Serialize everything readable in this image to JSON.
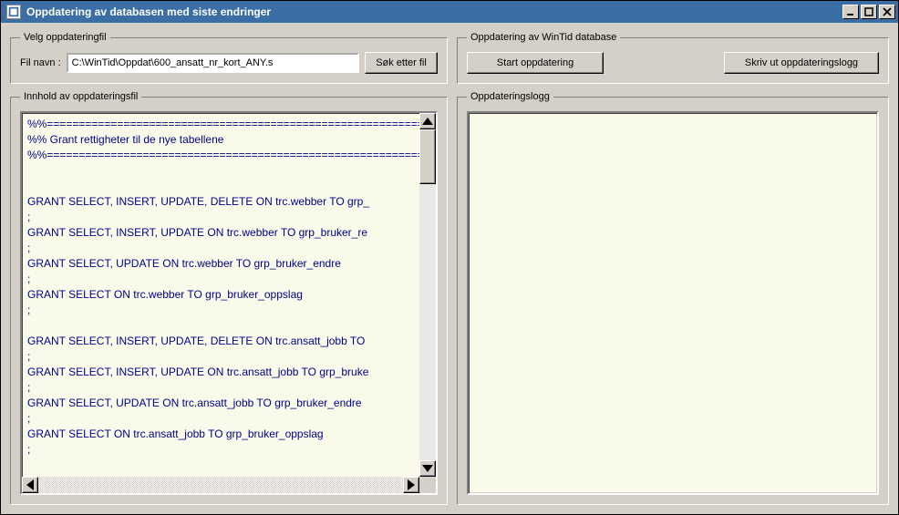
{
  "window": {
    "title": "Oppdatering av databasen med siste endringer"
  },
  "groups": {
    "selectFile": "Velg oppdateringfil",
    "dbUpdate": "Oppdatering av WinTid database",
    "fileContents": "Innhold av oppdateringsfil",
    "log": "Oppdateringslogg"
  },
  "labels": {
    "fileName": "Fil navn :"
  },
  "buttons": {
    "browse": "Søk etter fil",
    "start": "Start oppdatering",
    "printLog": "Skriv ut oppdateringslogg"
  },
  "fields": {
    "filePath": "C:\\WinTid\\Oppdat\\600_ansatt_nr_kort_ANY.s"
  },
  "fileContentLines": [
    "%%==============================================================================",
    "%% Grant rettigheter til de nye tabellene",
    "%%==============================================================================",
    "",
    "",
    "GRANT SELECT, INSERT, UPDATE, DELETE ON trc.webber TO grp_",
    ";",
    "GRANT SELECT, INSERT, UPDATE  ON trc.webber TO grp_bruker_re",
    ";",
    "GRANT SELECT, UPDATE ON trc.webber TO grp_bruker_endre",
    ";",
    "GRANT SELECT ON trc.webber TO grp_bruker_oppslag",
    ";",
    "",
    "GRANT SELECT, INSERT, UPDATE, DELETE ON trc.ansatt_jobb TO",
    ";",
    "GRANT SELECT, INSERT, UPDATE  ON trc.ansatt_jobb TO grp_bruke",
    ";",
    "GRANT SELECT, UPDATE ON trc.ansatt_jobb TO grp_bruker_endre",
    ";",
    "GRANT SELECT ON trc.ansatt_jobb TO grp_bruker_oppslag",
    ";"
  ],
  "logLines": []
}
